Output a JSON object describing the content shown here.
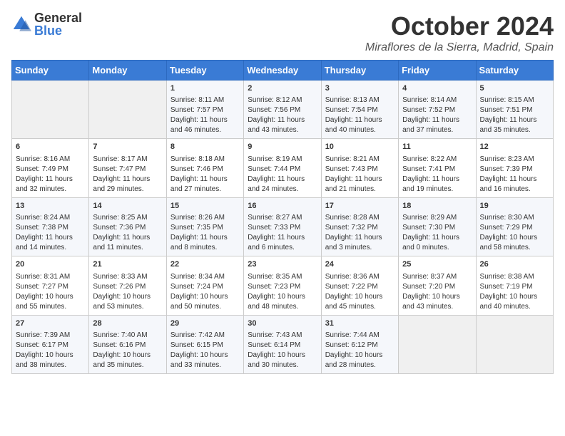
{
  "header": {
    "logo_general": "General",
    "logo_blue": "Blue",
    "month": "October 2024",
    "location": "Miraflores de la Sierra, Madrid, Spain"
  },
  "weekdays": [
    "Sunday",
    "Monday",
    "Tuesday",
    "Wednesday",
    "Thursday",
    "Friday",
    "Saturday"
  ],
  "weeks": [
    [
      {
        "day": "",
        "sunrise": "",
        "sunset": "",
        "daylight": ""
      },
      {
        "day": "",
        "sunrise": "",
        "sunset": "",
        "daylight": ""
      },
      {
        "day": "1",
        "sunrise": "Sunrise: 8:11 AM",
        "sunset": "Sunset: 7:57 PM",
        "daylight": "Daylight: 11 hours and 46 minutes."
      },
      {
        "day": "2",
        "sunrise": "Sunrise: 8:12 AM",
        "sunset": "Sunset: 7:56 PM",
        "daylight": "Daylight: 11 hours and 43 minutes."
      },
      {
        "day": "3",
        "sunrise": "Sunrise: 8:13 AM",
        "sunset": "Sunset: 7:54 PM",
        "daylight": "Daylight: 11 hours and 40 minutes."
      },
      {
        "day": "4",
        "sunrise": "Sunrise: 8:14 AM",
        "sunset": "Sunset: 7:52 PM",
        "daylight": "Daylight: 11 hours and 37 minutes."
      },
      {
        "day": "5",
        "sunrise": "Sunrise: 8:15 AM",
        "sunset": "Sunset: 7:51 PM",
        "daylight": "Daylight: 11 hours and 35 minutes."
      }
    ],
    [
      {
        "day": "6",
        "sunrise": "Sunrise: 8:16 AM",
        "sunset": "Sunset: 7:49 PM",
        "daylight": "Daylight: 11 hours and 32 minutes."
      },
      {
        "day": "7",
        "sunrise": "Sunrise: 8:17 AM",
        "sunset": "Sunset: 7:47 PM",
        "daylight": "Daylight: 11 hours and 29 minutes."
      },
      {
        "day": "8",
        "sunrise": "Sunrise: 8:18 AM",
        "sunset": "Sunset: 7:46 PM",
        "daylight": "Daylight: 11 hours and 27 minutes."
      },
      {
        "day": "9",
        "sunrise": "Sunrise: 8:19 AM",
        "sunset": "Sunset: 7:44 PM",
        "daylight": "Daylight: 11 hours and 24 minutes."
      },
      {
        "day": "10",
        "sunrise": "Sunrise: 8:21 AM",
        "sunset": "Sunset: 7:43 PM",
        "daylight": "Daylight: 11 hours and 21 minutes."
      },
      {
        "day": "11",
        "sunrise": "Sunrise: 8:22 AM",
        "sunset": "Sunset: 7:41 PM",
        "daylight": "Daylight: 11 hours and 19 minutes."
      },
      {
        "day": "12",
        "sunrise": "Sunrise: 8:23 AM",
        "sunset": "Sunset: 7:39 PM",
        "daylight": "Daylight: 11 hours and 16 minutes."
      }
    ],
    [
      {
        "day": "13",
        "sunrise": "Sunrise: 8:24 AM",
        "sunset": "Sunset: 7:38 PM",
        "daylight": "Daylight: 11 hours and 14 minutes."
      },
      {
        "day": "14",
        "sunrise": "Sunrise: 8:25 AM",
        "sunset": "Sunset: 7:36 PM",
        "daylight": "Daylight: 11 hours and 11 minutes."
      },
      {
        "day": "15",
        "sunrise": "Sunrise: 8:26 AM",
        "sunset": "Sunset: 7:35 PM",
        "daylight": "Daylight: 11 hours and 8 minutes."
      },
      {
        "day": "16",
        "sunrise": "Sunrise: 8:27 AM",
        "sunset": "Sunset: 7:33 PM",
        "daylight": "Daylight: 11 hours and 6 minutes."
      },
      {
        "day": "17",
        "sunrise": "Sunrise: 8:28 AM",
        "sunset": "Sunset: 7:32 PM",
        "daylight": "Daylight: 11 hours and 3 minutes."
      },
      {
        "day": "18",
        "sunrise": "Sunrise: 8:29 AM",
        "sunset": "Sunset: 7:30 PM",
        "daylight": "Daylight: 11 hours and 0 minutes."
      },
      {
        "day": "19",
        "sunrise": "Sunrise: 8:30 AM",
        "sunset": "Sunset: 7:29 PM",
        "daylight": "Daylight: 10 hours and 58 minutes."
      }
    ],
    [
      {
        "day": "20",
        "sunrise": "Sunrise: 8:31 AM",
        "sunset": "Sunset: 7:27 PM",
        "daylight": "Daylight: 10 hours and 55 minutes."
      },
      {
        "day": "21",
        "sunrise": "Sunrise: 8:33 AM",
        "sunset": "Sunset: 7:26 PM",
        "daylight": "Daylight: 10 hours and 53 minutes."
      },
      {
        "day": "22",
        "sunrise": "Sunrise: 8:34 AM",
        "sunset": "Sunset: 7:24 PM",
        "daylight": "Daylight: 10 hours and 50 minutes."
      },
      {
        "day": "23",
        "sunrise": "Sunrise: 8:35 AM",
        "sunset": "Sunset: 7:23 PM",
        "daylight": "Daylight: 10 hours and 48 minutes."
      },
      {
        "day": "24",
        "sunrise": "Sunrise: 8:36 AM",
        "sunset": "Sunset: 7:22 PM",
        "daylight": "Daylight: 10 hours and 45 minutes."
      },
      {
        "day": "25",
        "sunrise": "Sunrise: 8:37 AM",
        "sunset": "Sunset: 7:20 PM",
        "daylight": "Daylight: 10 hours and 43 minutes."
      },
      {
        "day": "26",
        "sunrise": "Sunrise: 8:38 AM",
        "sunset": "Sunset: 7:19 PM",
        "daylight": "Daylight: 10 hours and 40 minutes."
      }
    ],
    [
      {
        "day": "27",
        "sunrise": "Sunrise: 7:39 AM",
        "sunset": "Sunset: 6:17 PM",
        "daylight": "Daylight: 10 hours and 38 minutes."
      },
      {
        "day": "28",
        "sunrise": "Sunrise: 7:40 AM",
        "sunset": "Sunset: 6:16 PM",
        "daylight": "Daylight: 10 hours and 35 minutes."
      },
      {
        "day": "29",
        "sunrise": "Sunrise: 7:42 AM",
        "sunset": "Sunset: 6:15 PM",
        "daylight": "Daylight: 10 hours and 33 minutes."
      },
      {
        "day": "30",
        "sunrise": "Sunrise: 7:43 AM",
        "sunset": "Sunset: 6:14 PM",
        "daylight": "Daylight: 10 hours and 30 minutes."
      },
      {
        "day": "31",
        "sunrise": "Sunrise: 7:44 AM",
        "sunset": "Sunset: 6:12 PM",
        "daylight": "Daylight: 10 hours and 28 minutes."
      },
      {
        "day": "",
        "sunrise": "",
        "sunset": "",
        "daylight": ""
      },
      {
        "day": "",
        "sunrise": "",
        "sunset": "",
        "daylight": ""
      }
    ]
  ]
}
